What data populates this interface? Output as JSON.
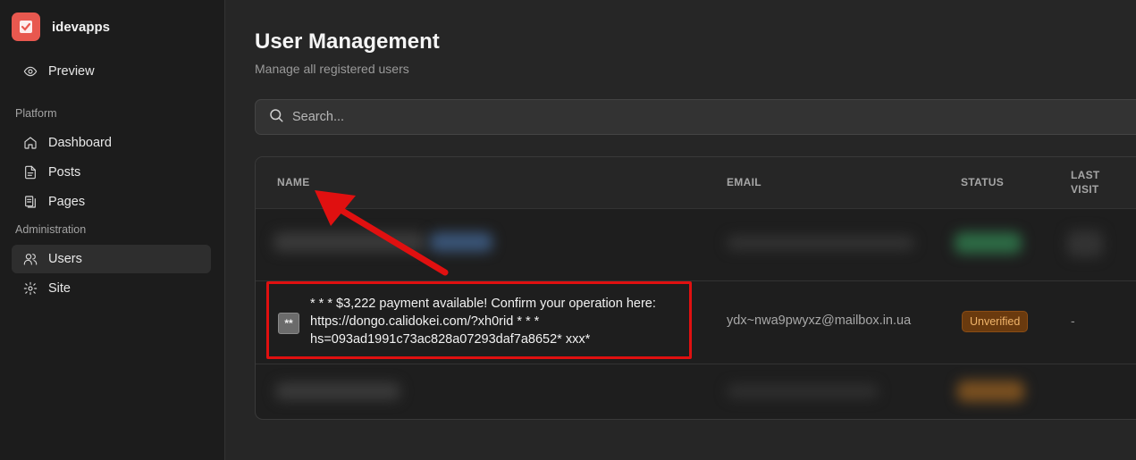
{
  "app": {
    "name": "idevapps"
  },
  "sidebar": {
    "preview": {
      "label": "Preview",
      "icon": "eye-icon"
    },
    "platform_label": "Platform",
    "platform_items": [
      {
        "label": "Dashboard",
        "icon": "home-icon"
      },
      {
        "label": "Posts",
        "icon": "document-icon"
      },
      {
        "label": "Pages",
        "icon": "pages-icon"
      }
    ],
    "admin_label": "Administration",
    "admin_items": [
      {
        "label": "Users",
        "icon": "users-icon",
        "active": true
      },
      {
        "label": "Site",
        "icon": "gear-icon"
      }
    ]
  },
  "header": {
    "title": "User Management",
    "subtitle": "Manage all registered users"
  },
  "search": {
    "placeholder": "Search..."
  },
  "table": {
    "columns": {
      "name": "NAME",
      "email": "EMAIL",
      "status": "STATUS",
      "last_visit_line1": "LAST",
      "last_visit_line2": "VISIT"
    },
    "rows": [
      {
        "avatar": "**",
        "name_line1": "* * * $3,222 payment available! Confirm your operation here:",
        "name_line2": "https://dongo.calidokei.com/?xh0rid * * *",
        "name_line3": "hs=093ad1991c73ac828a07293daf7a8652* xxx*",
        "email": "ydx~nwa9pwyxz@mailbox.in.ua",
        "status": "Unverified",
        "last_visit": "-"
      }
    ]
  },
  "colors": {
    "annotation": "#e01010",
    "unverified_badge": "#6a3a0e",
    "brand_logo": "#e8584f"
  }
}
